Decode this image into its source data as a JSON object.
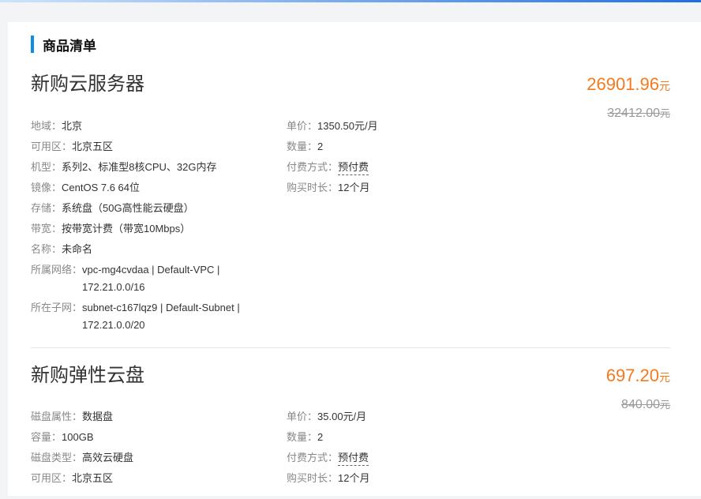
{
  "section": {
    "title": "商品清单"
  },
  "products": [
    {
      "name": "新购云服务器",
      "price": "26901.96",
      "original_price": "32412.00",
      "currency_unit": "元",
      "specs": [
        {
          "label": "地域：",
          "value": "北京"
        },
        {
          "label": "可用区：",
          "value": "北京五区"
        },
        {
          "label": "机型：",
          "value": "系列2、标准型8核CPU、32G内存"
        },
        {
          "label": "镜像：",
          "value": "CentOS 7.6 64位"
        },
        {
          "label": "存储：",
          "value": "系统盘（50G高性能云硬盘）"
        },
        {
          "label": "带宽：",
          "value": "按带宽计费（带宽10Mbps）"
        },
        {
          "label": "名称：",
          "value": "未命名"
        },
        {
          "label": "所属网络：",
          "value": "vpc-mg4cvdaa | Default-VPC | 172.21.0.0/16"
        },
        {
          "label": "所在子网：",
          "value": "subnet-c167lqz9 | Default-Subnet | 172.21.0.0/20"
        }
      ],
      "billing": [
        {
          "label": "单价：",
          "value": "1350.50元/月"
        },
        {
          "label": "数量：",
          "value": "2"
        },
        {
          "label": "付费方式：",
          "value": "预付费"
        },
        {
          "label": "购买时长：",
          "value": "12个月"
        }
      ]
    },
    {
      "name": "新购弹性云盘",
      "price": "697.20",
      "original_price": "840.00",
      "currency_unit": "元",
      "specs": [
        {
          "label": "磁盘属性：",
          "value": "数据盘"
        },
        {
          "label": "容量：",
          "value": "100GB"
        },
        {
          "label": "磁盘类型：",
          "value": "高效云硬盘"
        },
        {
          "label": "可用区：",
          "value": "北京五区"
        }
      ],
      "billing": [
        {
          "label": "单价：",
          "value": "35.00元/月"
        },
        {
          "label": "数量：",
          "value": "2"
        },
        {
          "label": "付费方式：",
          "value": "预付费"
        },
        {
          "label": "购买时长：",
          "value": "12个月"
        }
      ]
    }
  ]
}
